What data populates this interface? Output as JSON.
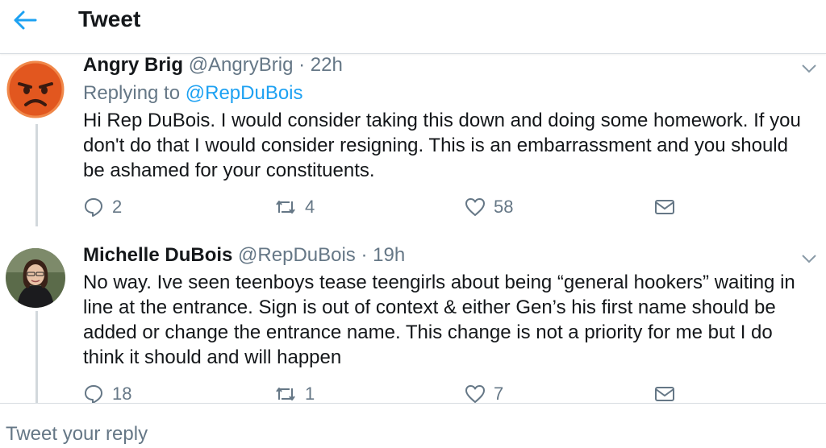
{
  "header": {
    "title": "Tweet"
  },
  "tweets": [
    {
      "name": "Angry Brig",
      "handle": "@AngryBrig",
      "dot": "·",
      "time": "22h",
      "replying_prefix": "Replying to",
      "replying_to": "@RepDuBois",
      "text": "Hi Rep DuBois. I would consider taking this down and doing some homework. If you don't do that I would consider resigning. This is an embarrassment and you should be ashamed for your constituents.",
      "replies": "2",
      "retweets": "4",
      "likes": "58"
    },
    {
      "name": "Michelle DuBois",
      "handle": "@RepDuBois",
      "dot": "·",
      "time": "19h",
      "text": "No way. Ive seen teenboys tease teengirls about being “general hookers” waiting in line at the entrance. Sign is out of context & either Gen’s his first name should be added or change the entrance name. This change is not a priority for me but I do think it should and will happen",
      "replies": "18",
      "retweets": "1",
      "likes": "7"
    }
  ],
  "reply_bar": {
    "placeholder": "Tweet your reply"
  },
  "colors": {
    "accent": "#1da1f2",
    "muted": "#657786",
    "text": "#14171a",
    "divider": "#d8dde2"
  },
  "icons": [
    "back-arrow-icon",
    "chevron-down-icon",
    "reply-icon",
    "retweet-icon",
    "like-icon",
    "share-mail-icon"
  ]
}
